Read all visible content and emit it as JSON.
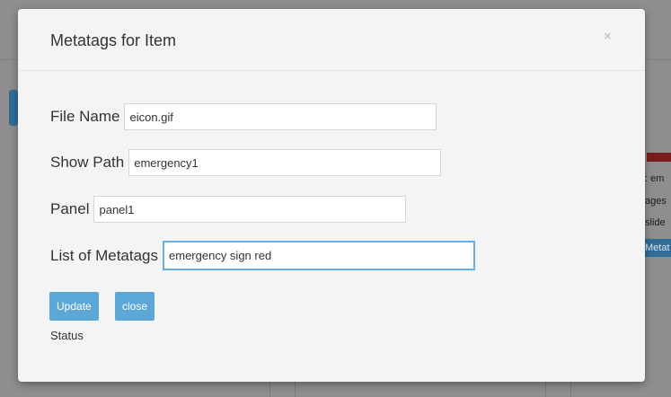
{
  "modal": {
    "title": "Metatags for Item",
    "close_glyph": "×",
    "fields": {
      "file_name": {
        "label": "File Name",
        "value": "eicon.gif"
      },
      "show_path": {
        "label": "Show Path",
        "value": "emergency1"
      },
      "panel": {
        "label": "Panel",
        "value": "panel1"
      },
      "metatags": {
        "label": "List of Metatags",
        "value": "emergency sign red"
      }
    },
    "buttons": {
      "update": "Update",
      "close": "close"
    },
    "status_label": "Status"
  },
  "background": {
    "side_texts": [
      ": em",
      "ages",
      "slide"
    ],
    "side_badge": "Metat"
  },
  "colors": {
    "button": "#5aa7d8",
    "focus_border": "#66afe9",
    "backdrop": "#8e8e8e"
  }
}
